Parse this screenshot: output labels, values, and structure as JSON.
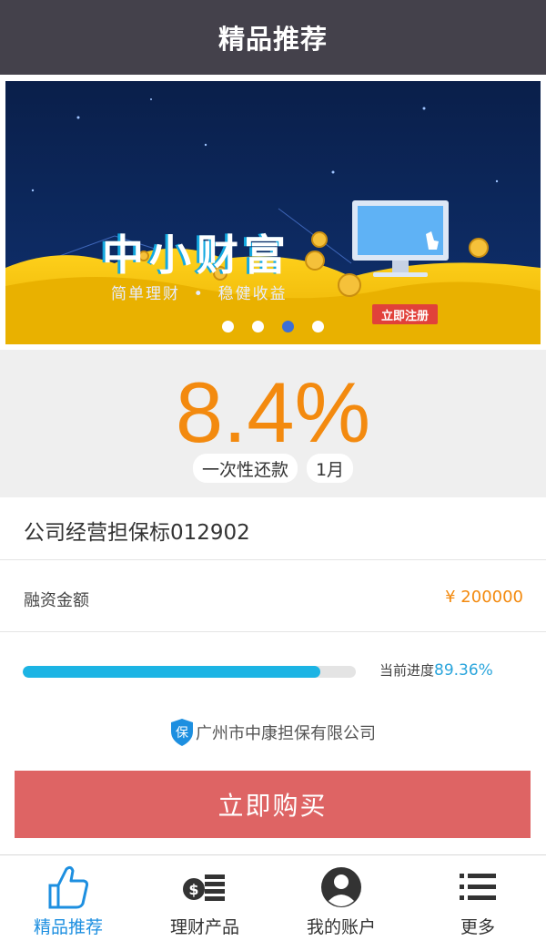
{
  "header": {
    "title": "精品推荐"
  },
  "banner": {
    "headline": "中小财富",
    "slogan": "简单理财  •  稳健收益",
    "cta": "立即注册",
    "slides": 4,
    "active_slide": 3
  },
  "rate": {
    "value": "8.4%",
    "repayment": "一次性还款",
    "term": "1月"
  },
  "product": {
    "title": "公司经营担保标012902",
    "amount_label": "融资金额",
    "amount_value": "¥ 200000"
  },
  "progress": {
    "label": "当前进度",
    "percent_text": "89.36%",
    "percent": 89.36
  },
  "guarantor": {
    "badge": "保",
    "name": "广州市中康担保有限公司"
  },
  "buy_button": {
    "label": "立即购买"
  },
  "tabbar": {
    "items": [
      {
        "label": "精品推荐",
        "icon": "thumbs-up-icon",
        "active": true
      },
      {
        "label": "理财产品",
        "icon": "money-stack-icon",
        "active": false
      },
      {
        "label": "我的账户",
        "icon": "user-avatar-icon",
        "active": false
      },
      {
        "label": "更多",
        "icon": "list-menu-icon",
        "active": false
      }
    ]
  },
  "colors": {
    "header_bg": "#44414b",
    "accent_orange": "#f38a0f",
    "progress_blue": "#1cb4e4",
    "buy_red": "#de6464",
    "active_tab": "#1d8fe0"
  }
}
